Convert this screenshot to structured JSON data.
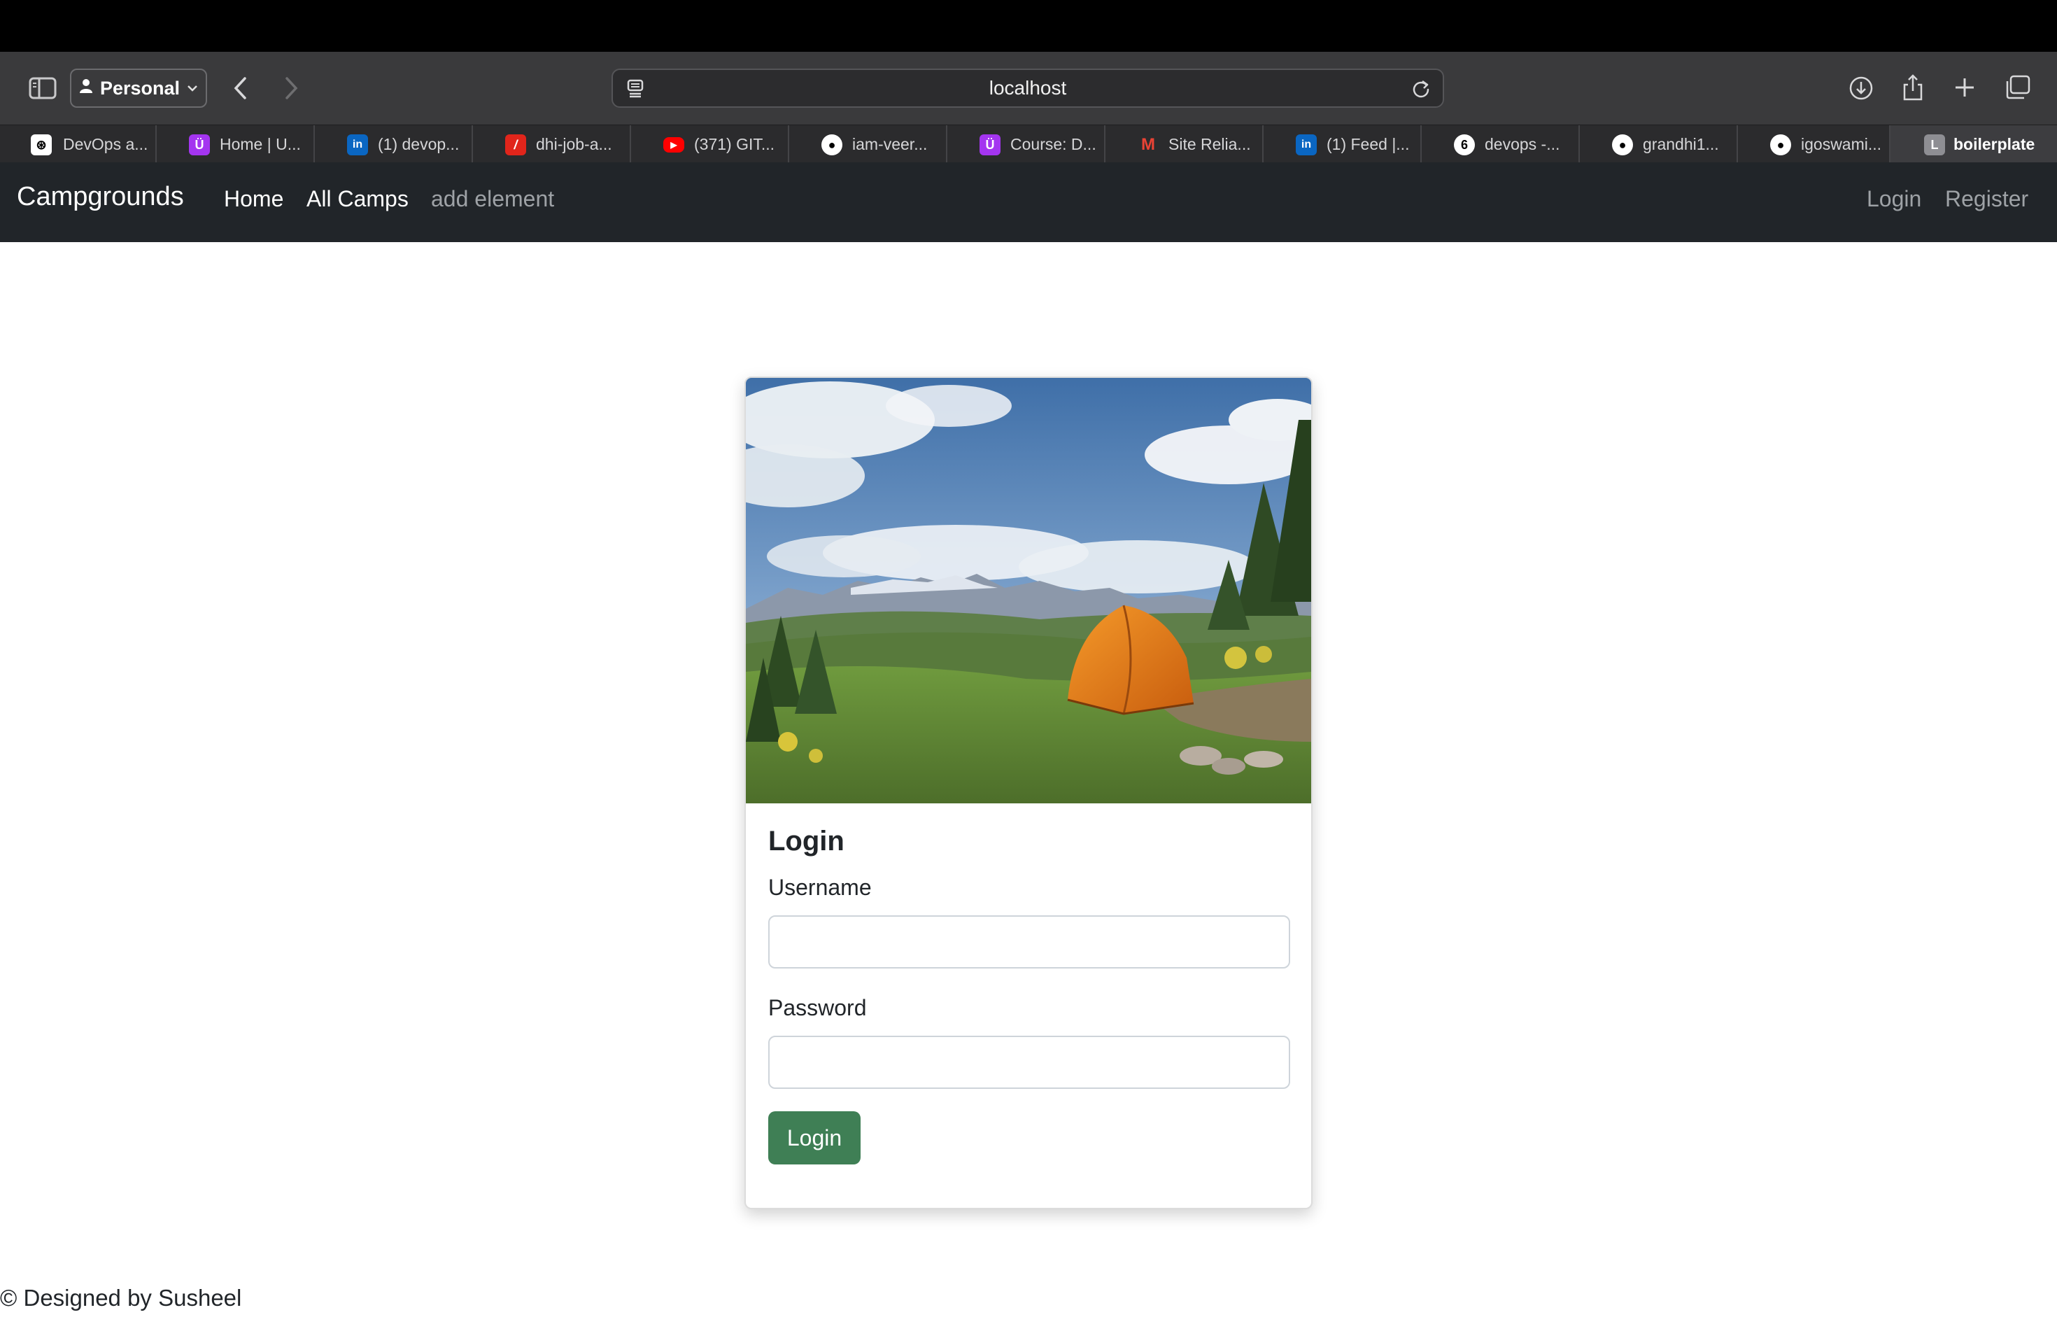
{
  "browser": {
    "profile_label": "Personal",
    "url": "localhost",
    "tabs": [
      {
        "label": "DevOps a...",
        "icon": "openai-icon"
      },
      {
        "label": "Home | U...",
        "icon": "udemy-icon"
      },
      {
        "label": "(1) devop...",
        "icon": "linkedin-icon"
      },
      {
        "label": "dhi-job-a...",
        "icon": "dice-icon"
      },
      {
        "label": "(371) GIT...",
        "icon": "youtube-icon"
      },
      {
        "label": "iam-veer...",
        "icon": "github-icon"
      },
      {
        "label": "Course: D...",
        "icon": "udemy-icon"
      },
      {
        "label": "Site Relia...",
        "icon": "gmail-icon"
      },
      {
        "label": "(1) Feed |...",
        "icon": "linkedin-icon"
      },
      {
        "label": "devops -...",
        "icon": "chatgpt-icon"
      },
      {
        "label": "grandhi1...",
        "icon": "github-icon"
      },
      {
        "label": "igoswami...",
        "icon": "github-icon"
      },
      {
        "label": "boilerplate",
        "icon": "letter-l-icon",
        "active": true,
        "icon_letter": "L"
      }
    ]
  },
  "navbar": {
    "brand": "Campgrounds",
    "links": {
      "home": "Home",
      "all_camps": "All Camps",
      "add_element": "add element",
      "login": "Login",
      "register": "Register"
    }
  },
  "login_card": {
    "title": "Login",
    "username_label": "Username",
    "username_value": "",
    "password_label": "Password",
    "password_value": "",
    "submit_label": "Login"
  },
  "footer": {
    "text": "© Designed by Susheel"
  },
  "colors": {
    "navbar_bg": "#212529",
    "button_green": "#3f7f55",
    "toolbar_bg": "#3a3a3c"
  }
}
